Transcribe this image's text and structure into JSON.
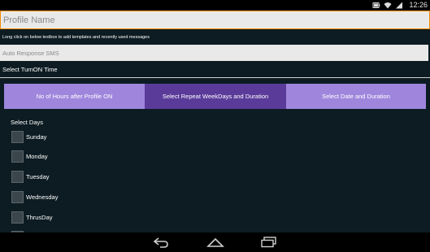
{
  "status_bar": {
    "time": "12:26",
    "icons": [
      "battery-icon",
      "wifi-icon",
      "signal-icon"
    ]
  },
  "profile": {
    "name_placeholder": "Profile Name",
    "hint": "Long click on below textbox to add templates and recently used messages",
    "sms_placeholder": "Auto Response SMS"
  },
  "turn_on": {
    "label": "Select TurnON Time"
  },
  "tabs": [
    {
      "label": "No of Hours after Profile ON",
      "active": false
    },
    {
      "label": "Select Repeat WeekDays and Duration",
      "active": true
    },
    {
      "label": "Select Date and Duration",
      "active": false
    }
  ],
  "days": {
    "label": "Select Days",
    "items": [
      {
        "label": "Sunday",
        "checked": false
      },
      {
        "label": "Monday",
        "checked": false
      },
      {
        "label": "Tuesday",
        "checked": false
      },
      {
        "label": "Wednesday",
        "checked": false
      },
      {
        "label": "ThrusDay",
        "checked": false
      }
    ]
  },
  "nav_bar": {
    "buttons": [
      "back-icon",
      "home-icon",
      "recent-apps-icon"
    ]
  },
  "colors": {
    "background": "#0d1c22",
    "tab_active": "#5a3b9a",
    "tab_inactive": "#9f86dc",
    "input_focus_border": "#f08a00"
  }
}
